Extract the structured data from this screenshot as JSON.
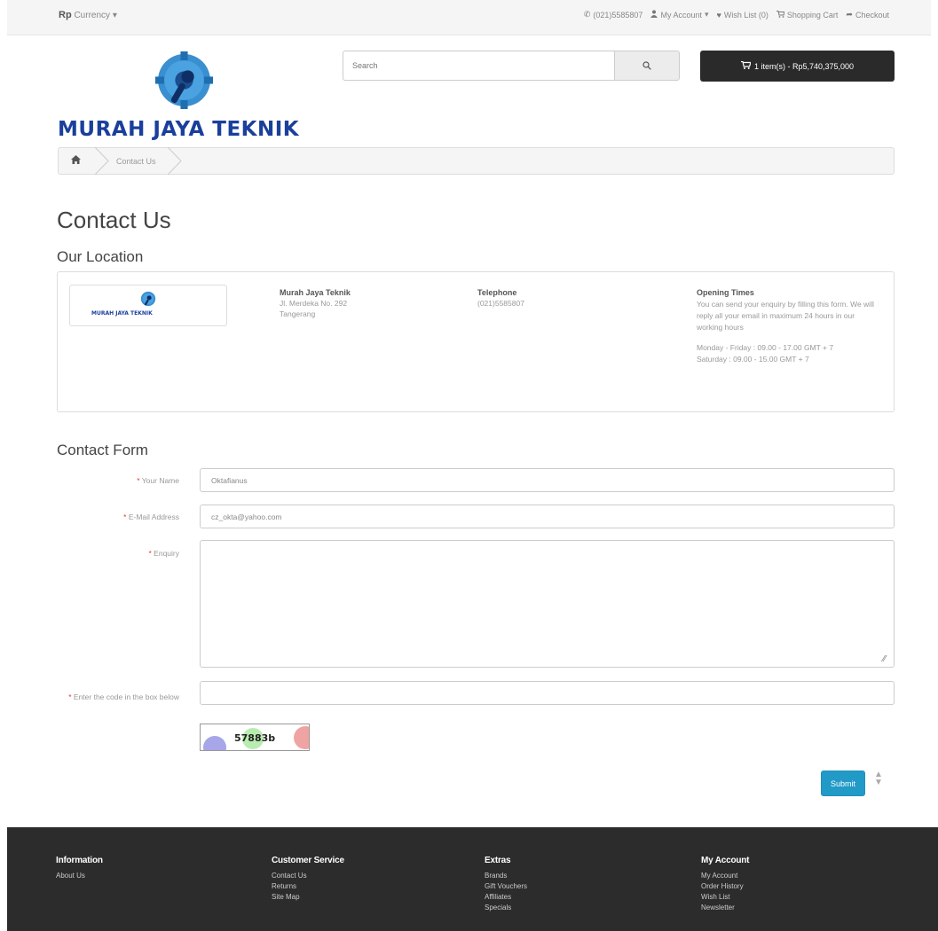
{
  "topbar": {
    "currency_symbol": "Rp",
    "currency_label": "Currency",
    "links": [
      {
        "icon": "phone-icon",
        "label": "(021)5585807"
      },
      {
        "icon": "user-icon",
        "label": "My Account"
      },
      {
        "icon": "heart-icon",
        "label": "Wish List (0)"
      },
      {
        "icon": "cart-icon",
        "label": "Shopping Cart"
      },
      {
        "icon": "share-icon",
        "label": "Checkout"
      }
    ]
  },
  "header": {
    "logo_text": "MURAH JAYA TEKNIK",
    "search_placeholder": "Search",
    "cart_label": "1 item(s) - Rp5,740,375,000"
  },
  "breadcrumb": {
    "items": [
      "Contact Us"
    ]
  },
  "page": {
    "title": "Contact Us",
    "location_heading": "Our Location"
  },
  "location": {
    "thumb_text": "MURAH JAYA TEKNIK",
    "store_name": "Murah Jaya Teknik",
    "address_line1": "Jl. Merdeka No. 292",
    "address_line2": "Tangerang",
    "telephone_heading": "Telephone",
    "telephone": "(021)5585807",
    "opening_heading": "Opening Times",
    "opening_text": "You can send your enquiry by filling this form. We will reply all your email in maximum 24 hours in our working hours",
    "hours_weekday": "Monday - Friday : 09.00 - 17.00 GMT + 7",
    "hours_saturday": "Saturday : 09.00 - 15.00 GMT + 7"
  },
  "form": {
    "heading": "Contact Form",
    "name_label": "Your Name",
    "name_value": "Oktafianus",
    "email_label": "E-Mail Address",
    "email_value": "cz_okta@yahoo.com",
    "enquiry_label": "Enquiry",
    "enquiry_value": "",
    "code_label": "Enter the code in the box below",
    "code_value": "",
    "captcha_text": "57883b",
    "submit_label": "Submit"
  },
  "footer": {
    "columns": [
      {
        "heading": "Information",
        "links": [
          "About Us"
        ]
      },
      {
        "heading": "Customer Service",
        "links": [
          "Contact Us",
          "Returns",
          "Site Map"
        ]
      },
      {
        "heading": "Extras",
        "links": [
          "Brands",
          "Gift Vouchers",
          "Affiliates",
          "Specials"
        ]
      },
      {
        "heading": "My Account",
        "links": [
          "My Account",
          "Order History",
          "Wish List",
          "Newsletter"
        ]
      }
    ]
  },
  "colors": {
    "brand_blue": "#1a3f9c",
    "button_blue": "#229ac8",
    "required_red": "#e03c31",
    "footer_bg": "#2c2c2c"
  }
}
